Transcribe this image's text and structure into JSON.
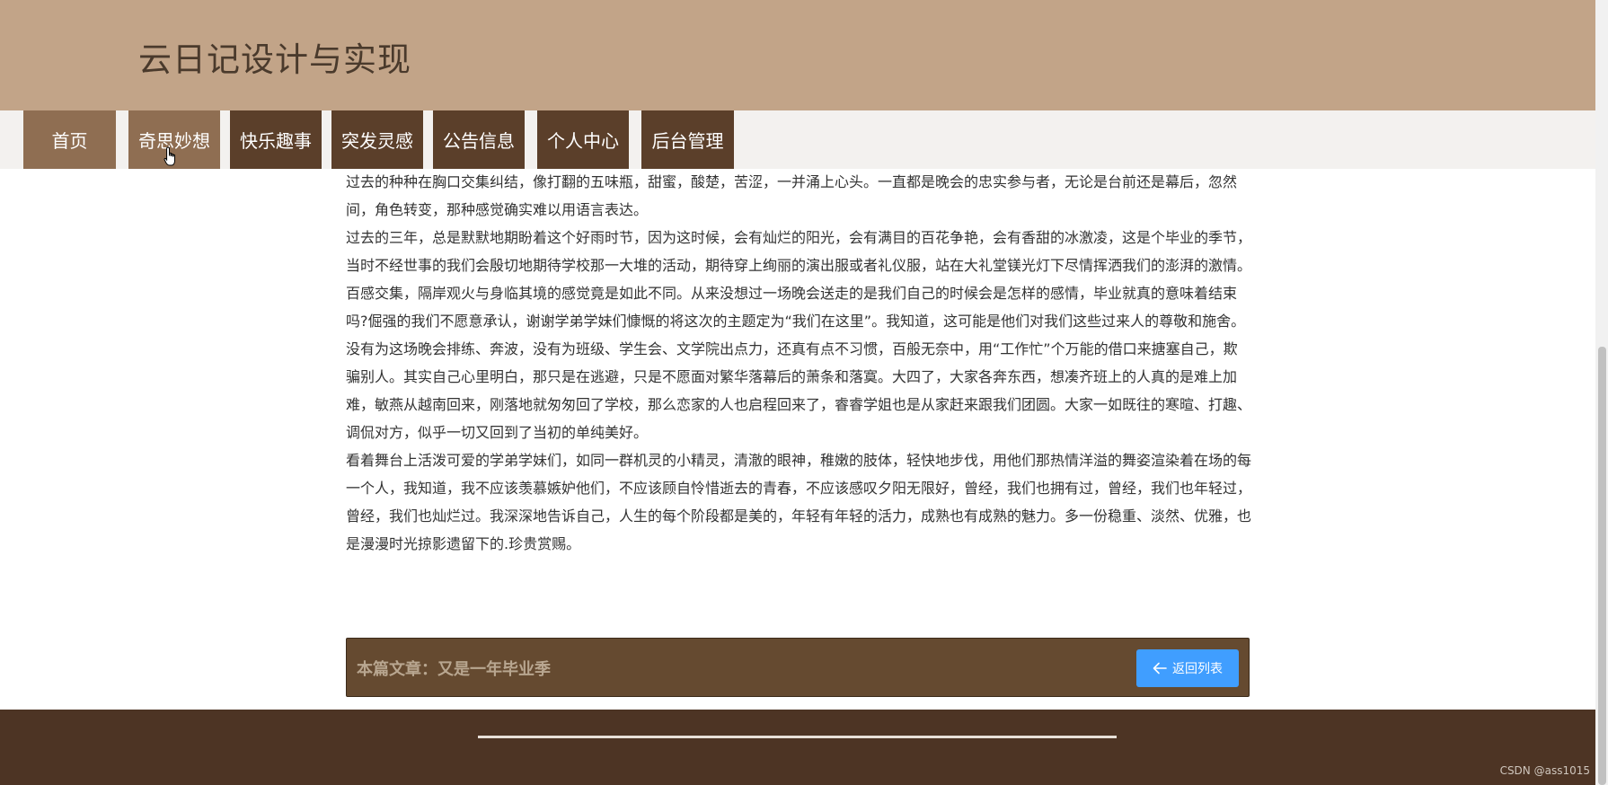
{
  "site": {
    "title": "云日记设计与实现"
  },
  "nav": {
    "items": [
      {
        "label": "首页"
      },
      {
        "label": "奇思妙想"
      },
      {
        "label": "快乐趣事"
      },
      {
        "label": "突发灵感"
      },
      {
        "label": "公告信息"
      },
      {
        "label": "个人中心"
      },
      {
        "label": "后台管理"
      }
    ],
    "hovered_item": "奇思妙想"
  },
  "article": {
    "paragraphs": [
      "过去的种种在胸口交集纠结，像打翻的五味瓶，甜蜜，酸楚，苦涩，一并涌上心头。一直都是晚会的忠实参与者，无论是台前还是幕后，忽然间，角色转变，那种感觉确实难以用语言表达。",
      "过去的三年，总是默默地期盼着这个好雨时节，因为这时候，会有灿烂的阳光，会有满目的百花争艳，会有香甜的冰激凌，这是个毕业的季节，当时不经世事的我们会殷切地期待学校那一大堆的活动，期待穿上绚丽的演出服或者礼仪服，站在大礼堂镁光灯下尽情挥洒我们的澎湃的激情。",
      "百感交集，隔岸观火与身临其境的感觉竟是如此不同。从来没想过一场晚会送走的是我们自己的时候会是怎样的感情，毕业就真的意味着结束吗?倔强的我们不愿意承认，谢谢学弟学妹们慷慨的将这次的主题定为“我们在这里”。我知道，这可能是他们对我们这些过来人的尊敬和施舍。",
      "没有为这场晚会排练、奔波，没有为班级、学生会、文学院出点力，还真有点不习惯，百般无奈中，用“工作忙”个万能的借口来搪塞自己，欺骗别人。其实自己心里明白，那只是在逃避，只是不愿面对繁华落幕后的萧条和落寞。大四了，大家各奔东西，想凑齐班上的人真的是难上加难，敏燕从越南回来，刚落地就匆匆回了学校，那么恋家的人也启程回来了，睿睿学姐也是从家赶来跟我们团圆。大家一如既往的寒暄、打趣、调侃对方，似乎一切又回到了当初的单纯美好。",
      "看着舞台上活泼可爱的学弟学妹们，如同一群机灵的小精灵，清澈的眼神，稚嫩的肢体，轻快地步伐，用他们那热情洋溢的舞姿渲染着在场的每一个人，我知道，我不应该羡慕嫉妒他们，不应该顾自怜惜逝去的青春，不应该感叹夕阳无限好，曾经，我们也拥有过，曾经，我们也年轻过，曾经，我们也灿烂过。我深深地告诉自己，人生的每个阶段都是美的，年轻有年轻的活力，成熟也有成熟的魅力。多一份稳重、淡然、优雅，也是漫漫时光掠影遗留下的.珍贵赏赐。"
    ],
    "footer_label": "本篇文章：又是一年毕业季",
    "back_button_label": "返回列表"
  },
  "watermark": "CSDN @ass1015",
  "colors": {
    "header_bg": "#c2a488",
    "nav_light": "#8f6e52",
    "nav_dark": "#5b3f2a",
    "footer_bg": "#4d3424",
    "article_footer_bg": "#654a30",
    "accent_button": "#409eff"
  }
}
